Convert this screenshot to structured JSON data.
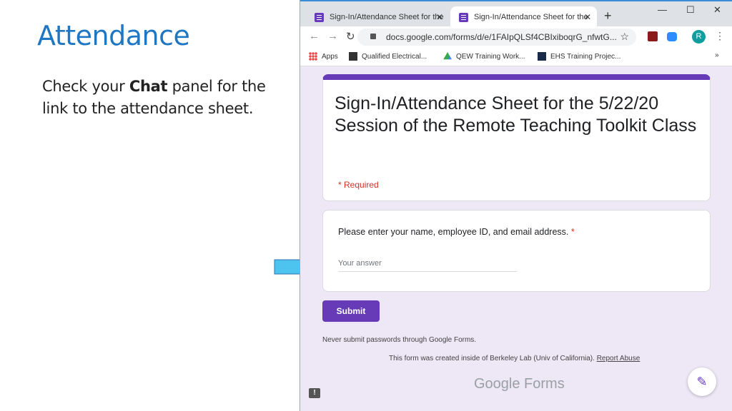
{
  "slide": {
    "title": "Attendance",
    "body_pre": "Check your ",
    "body_bold": "Chat",
    "body_post": " panel for the link to the attendance sheet."
  },
  "browser": {
    "tabs": [
      {
        "label": "Sign-In/Attendance Sheet for the"
      },
      {
        "label": "Sign-In/Attendance Sheet for the"
      }
    ],
    "url": "docs.google.com/forms/d/e/1FAIpQLSf4CBIxiboqrG_nfwtG...",
    "profile_initial": "R",
    "bookmarks": [
      {
        "label": "Apps"
      },
      {
        "label": "Qualified Electrical..."
      },
      {
        "label": "QEW Training Work..."
      },
      {
        "label": "EHS Training Projec..."
      }
    ],
    "more": "»"
  },
  "form": {
    "title": "Sign-In/Attendance Sheet for the 5/22/20 Session of the Remote Teaching Toolkit Class",
    "required_note": "* Required",
    "question": "Please enter your name, employee ID, and email address.",
    "required_mark": "*",
    "answer_placeholder": "Your answer",
    "submit_label": "Submit",
    "never_note": "Never submit passwords through Google Forms.",
    "created_note": "This form was created inside of Berkeley Lab (Univ of California).",
    "report_abuse": "Report Abuse",
    "logo": "Google Forms"
  },
  "colors": {
    "accent": "#673ab7",
    "arrow": "#4dc3f0",
    "title": "#1f77c4",
    "background": "#ede7f6"
  }
}
